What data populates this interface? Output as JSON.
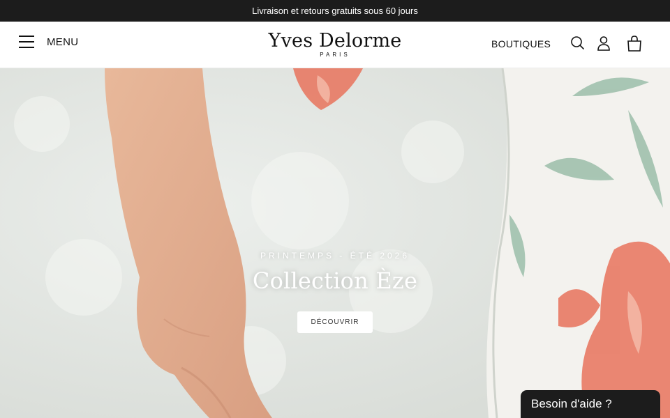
{
  "announcement": {
    "text": "Livraison et retours gratuits sous 60 jours"
  },
  "header": {
    "menu_label": "MENU",
    "logo": {
      "name": "Yves Delorme",
      "sub": "PARIS"
    },
    "boutiques_label": "BOUTIQUES",
    "icons": [
      "search-icon",
      "account-icon",
      "bag-icon"
    ]
  },
  "hero": {
    "eyebrow": "PRINTEMPS - ÉTÉ 2026",
    "title": "Collection Èze",
    "cta_label": "DÉCOUVRIR"
  },
  "help_widget": {
    "label": "Besoin d'aide ?"
  },
  "colors": {
    "topbar": "#1c1c1c",
    "header_bg": "#ffffff",
    "accent_coral": "#e8735c",
    "leaf_green": "#8fb7a0"
  }
}
